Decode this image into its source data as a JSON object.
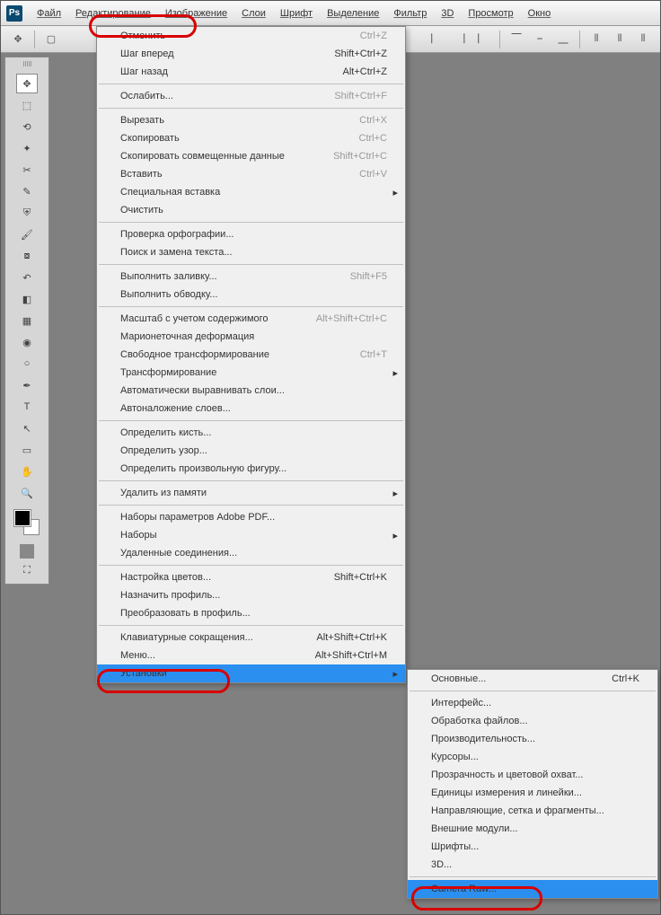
{
  "menubar": {
    "items": [
      "Файл",
      "Редактирование",
      "Изображение",
      "Слои",
      "Шрифт",
      "Выделение",
      "Фильтр",
      "3D",
      "Просмотр",
      "Окно"
    ]
  },
  "edit_menu": [
    {
      "label": "Отменить",
      "shortcut": "Ctrl+Z",
      "disabled": true
    },
    {
      "label": "Шаг вперед",
      "shortcut": "Shift+Ctrl+Z"
    },
    {
      "label": "Шаг назад",
      "shortcut": "Alt+Ctrl+Z"
    },
    {
      "sep": true
    },
    {
      "label": "Ослабить...",
      "shortcut": "Shift+Ctrl+F",
      "disabled": true
    },
    {
      "sep": true
    },
    {
      "label": "Вырезать",
      "shortcut": "Ctrl+X",
      "disabled": true
    },
    {
      "label": "Скопировать",
      "shortcut": "Ctrl+C",
      "disabled": true
    },
    {
      "label": "Скопировать совмещенные данные",
      "shortcut": "Shift+Ctrl+C",
      "disabled": true
    },
    {
      "label": "Вставить",
      "shortcut": "Ctrl+V",
      "disabled": true
    },
    {
      "label": "Специальная вставка",
      "submenu": true,
      "disabled": true
    },
    {
      "label": "Очистить",
      "disabled": true
    },
    {
      "sep": true
    },
    {
      "label": "Проверка орфографии...",
      "disabled": true
    },
    {
      "label": "Поиск и замена текста...",
      "disabled": true
    },
    {
      "sep": true
    },
    {
      "label": "Выполнить заливку...",
      "shortcut": "Shift+F5",
      "disabled": true
    },
    {
      "label": "Выполнить обводку...",
      "disabled": true
    },
    {
      "sep": true
    },
    {
      "label": "Масштаб с учетом содержимого",
      "shortcut": "Alt+Shift+Ctrl+C",
      "disabled": true
    },
    {
      "label": "Марионеточная деформация",
      "disabled": true
    },
    {
      "label": "Свободное трансформирование",
      "shortcut": "Ctrl+T",
      "disabled": true
    },
    {
      "label": "Трансформирование",
      "submenu": true,
      "disabled": true
    },
    {
      "label": "Автоматически выравнивать слои...",
      "disabled": true
    },
    {
      "label": "Автоналожение слоев...",
      "disabled": true
    },
    {
      "sep": true
    },
    {
      "label": "Определить кисть...",
      "disabled": true
    },
    {
      "label": "Определить узор...",
      "disabled": true
    },
    {
      "label": "Определить произвольную фигуру...",
      "disabled": true
    },
    {
      "sep": true
    },
    {
      "label": "Удалить из памяти",
      "submenu": true
    },
    {
      "sep": true
    },
    {
      "label": "Наборы параметров Adobe PDF..."
    },
    {
      "label": "Наборы",
      "submenu": true
    },
    {
      "label": "Удаленные соединения..."
    },
    {
      "sep": true
    },
    {
      "label": "Настройка цветов...",
      "shortcut": "Shift+Ctrl+K"
    },
    {
      "label": "Назначить профиль...",
      "disabled": true
    },
    {
      "label": "Преобразовать в профиль...",
      "disabled": true
    },
    {
      "sep": true
    },
    {
      "label": "Клавиатурные сокращения...",
      "shortcut": "Alt+Shift+Ctrl+K"
    },
    {
      "label": "Меню...",
      "shortcut": "Alt+Shift+Ctrl+M"
    },
    {
      "label": "Установки",
      "submenu": true,
      "selected": true
    }
  ],
  "prefs_submenu": [
    {
      "label": "Основные...",
      "shortcut": "Ctrl+K"
    },
    {
      "sep": true
    },
    {
      "label": "Интерфейс..."
    },
    {
      "label": "Обработка файлов..."
    },
    {
      "label": "Производительность..."
    },
    {
      "label": "Курсоры..."
    },
    {
      "label": "Прозрачность и цветовой охват..."
    },
    {
      "label": "Единицы измерения и линейки..."
    },
    {
      "label": "Направляющие, сетка и фрагменты..."
    },
    {
      "label": "Внешние модули..."
    },
    {
      "label": "Шрифты..."
    },
    {
      "label": "3D..."
    },
    {
      "sep": true
    },
    {
      "label": "Camera Raw...",
      "selected": true
    }
  ]
}
